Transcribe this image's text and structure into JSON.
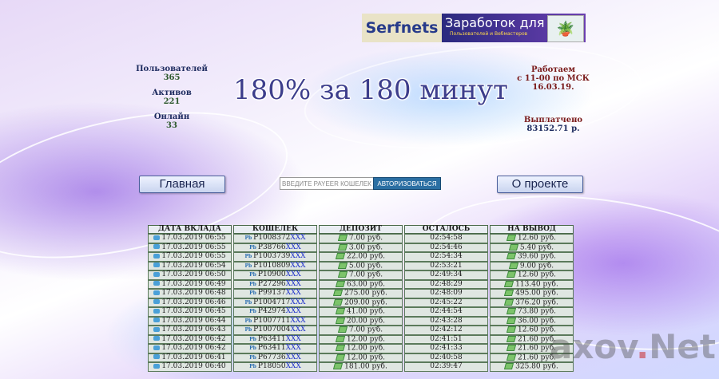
{
  "banner": {
    "brand": "Serfnets",
    "title": "Заработок для",
    "subtitle": "Пользователей и Вебмастеров"
  },
  "stats_left": [
    {
      "label": "Пользователей",
      "value": "365"
    },
    {
      "label": "Активов",
      "value": "221"
    },
    {
      "label": "Онлайн",
      "value": "33"
    }
  ],
  "stats_right": {
    "work_label": "Работаем",
    "work_line1": "с 11-00 по МСК",
    "work_line2": "16.03.19.",
    "paid_label": "Выплатчено",
    "paid_value": "83152.71 р."
  },
  "headline": "180% за 180 минут",
  "nav": {
    "home": "Главная",
    "about": "О проекте",
    "payeer_placeholder": "ВВЕДИТЕ PAYEER КОШЕЛЕК",
    "auth": "АВТОРИЗОВАТЬСЯ"
  },
  "table": {
    "headers": [
      "ДАТА ВКЛАДА",
      "КОШЕЛЕК",
      "ДЕПОЗИТ",
      "ОСТАЛОСЬ",
      "НА ВЫВОД"
    ],
    "mask": "XXX",
    "rows": [
      {
        "date": "17.03.2019 06:55",
        "wallet": "P1008372",
        "deposit": "7.00 руб.",
        "left": "02:54:58",
        "out": "12.60 руб."
      },
      {
        "date": "17.03.2019 06:55",
        "wallet": "P38766",
        "deposit": "3.00 руб.",
        "left": "02:54:46",
        "out": "5.40 руб."
      },
      {
        "date": "17.03.2019 06:55",
        "wallet": "P1003739",
        "deposit": "22.00 руб.",
        "left": "02:54:34",
        "out": "39.60 руб."
      },
      {
        "date": "17.03.2019 06:54",
        "wallet": "P1010809",
        "deposit": "5.00 руб.",
        "left": "02:53:21",
        "out": "9.00 руб."
      },
      {
        "date": "17.03.2019 06:50",
        "wallet": "P10900",
        "deposit": "7.00 руб.",
        "left": "02:49:34",
        "out": "12.60 руб."
      },
      {
        "date": "17.03.2019 06:49",
        "wallet": "P27296",
        "deposit": "63.00 руб.",
        "left": "02:48:29",
        "out": "113.40 руб."
      },
      {
        "date": "17.03.2019 06:48",
        "wallet": "P99137",
        "deposit": "275.00 руб.",
        "left": "02:48:09",
        "out": "495.00 руб."
      },
      {
        "date": "17.03.2019 06:46",
        "wallet": "P1004717",
        "deposit": "209.00 руб.",
        "left": "02:45:22",
        "out": "376.20 руб."
      },
      {
        "date": "17.03.2019 06:45",
        "wallet": "P42974",
        "deposit": "41.00 руб.",
        "left": "02:44:54",
        "out": "73.80 руб."
      },
      {
        "date": "17.03.2019 06:44",
        "wallet": "P1007711",
        "deposit": "20.00 руб.",
        "left": "02:43:28",
        "out": "36.00 руб."
      },
      {
        "date": "17.03.2019 06:43",
        "wallet": "P1007004",
        "deposit": "7.00 руб.",
        "left": "02:42:12",
        "out": "12.60 руб."
      },
      {
        "date": "17.03.2019 06:42",
        "wallet": "P63411",
        "deposit": "12.00 руб.",
        "left": "02:41:51",
        "out": "21.60 руб."
      },
      {
        "date": "17.03.2019 06:42",
        "wallet": "P63411",
        "deposit": "12.00 руб.",
        "left": "02:41:33",
        "out": "21.60 руб."
      },
      {
        "date": "17.03.2019 06:41",
        "wallet": "P67736",
        "deposit": "12.00 руб.",
        "left": "02:40:58",
        "out": "21.60 руб."
      },
      {
        "date": "17.03.2019 06:40",
        "wallet": "P18050",
        "deposit": "181.00 руб.",
        "left": "02:39:47",
        "out": "325.80 руб."
      }
    ]
  },
  "watermark": {
    "left": "axov",
    "dot": ".",
    "right": "Net"
  }
}
